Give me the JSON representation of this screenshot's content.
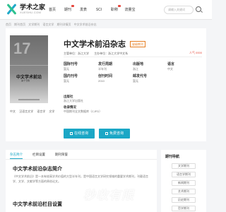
{
  "brand": {
    "name_cn": "学术之家",
    "name_en": "XUESHU.COM"
  },
  "nav": [
    {
      "label": "首页",
      "hot": false
    },
    {
      "label": "期刊",
      "hot": true
    },
    {
      "label": "发表",
      "hot": false
    },
    {
      "label": "SCI",
      "hot": false
    },
    {
      "label": "职称",
      "hot": true
    },
    {
      "label": "流量宝",
      "hot": false
    }
  ],
  "search": {
    "placeholder": "请输入关键词"
  },
  "breadcrumb": [
    "首页",
    "期刊首页",
    "文学期刊",
    "语言文学",
    "期刊详情页",
    "中文学术前沿杂志"
  ],
  "magazine": {
    "title": "中文学术前沿杂志",
    "badge": "省级期刊",
    "meta": [
      "主管单位：浙江大学",
      "主办单位：浙江大学中文系"
    ],
    "meta_right": "人气 0000",
    "info": [
      [
        {
          "label": "国际刊号",
          "value": "暂无"
        },
        {
          "label": "发行周期",
          "value": "半年刊"
        },
        {
          "label": "出版地",
          "value": "浙江"
        },
        {
          "label": "语言",
          "value": "中文"
        }
      ],
      [
        {
          "label": "国内刊号",
          "value": "暂无"
        },
        {
          "label": "创刊时间",
          "value": "2010"
        },
        {
          "label": "邮发代号",
          "value": "暂无"
        },
        {
          "label": "",
          "value": ""
        }
      ]
    ],
    "blocks": [
      {
        "label": "出版社",
        "value": "浙江大学出版社"
      },
      {
        "label": "收录情况",
        "value": "中国期刊全文数据库（CJFD）"
      }
    ],
    "tags": [
      "中文",
      "汉语言文学",
      "语言学",
      "文学"
    ],
    "cover": {
      "number": "17",
      "title": "中文学术前沿",
      "subtitle": "第十七辑"
    }
  },
  "buttons": {
    "consult": "在线咨询",
    "subscribe": "免费咨询"
  },
  "tabs": [
    {
      "label": "杂志简介",
      "active": true
    },
    {
      "label": "栏目设置",
      "active": false
    },
    {
      "label": "期刊荣誉",
      "active": false
    }
  ],
  "sections": [
    {
      "title": "中文学术前沿杂志简介",
      "text": "《中文学术前沿》是一本有较高学术价值的大型半年刊，是中国语言文学研究领域的重要学术期刊，刊载语言学、文学、文献学等方面的原创论文。"
    },
    {
      "title": "中文学术前沿栏目设置",
      "text": ""
    }
  ],
  "sidebar": {
    "title": "期刊导航",
    "items": [
      "文学期刊",
      "语言学期刊",
      "新闻期刊",
      "艺术期刊",
      "历史期刊",
      "哲学期刊"
    ]
  },
  "watermark": "秒收有限"
}
